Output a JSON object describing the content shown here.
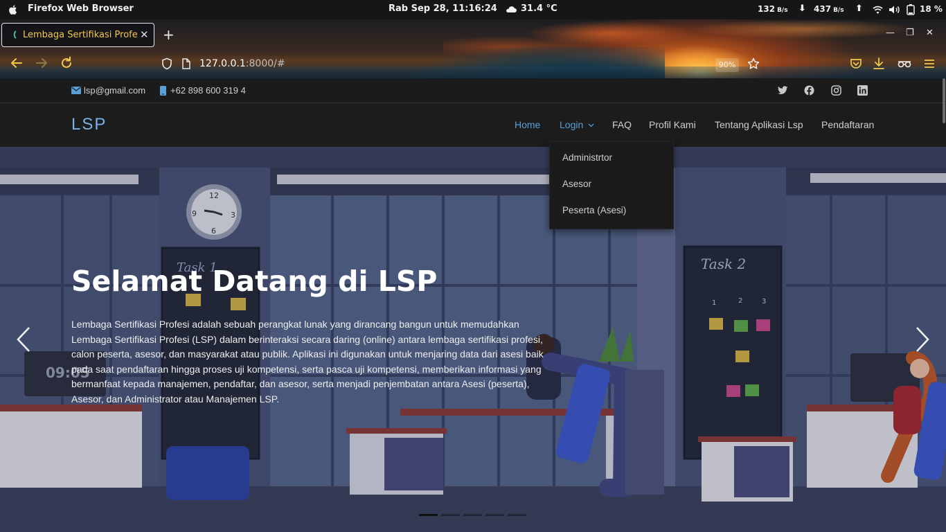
{
  "system_bar": {
    "app_name": "Firefox Web Browser",
    "datetime": "Rab Sep 28, 11:16:24",
    "temperature": "31.4 °C",
    "download_rate": "132",
    "download_unit": "B/s",
    "upload_rate": "437",
    "upload_unit": "B/s",
    "battery": "18 %"
  },
  "browser": {
    "tab_title": "Lembaga Sertifikasi Profesi",
    "new_tab": "+",
    "url_host": "127.0.0.1",
    "url_rest": ":8000/#",
    "zoom_level": "90%"
  },
  "topbar": {
    "email": "lsp@gmail.com",
    "phone": "+62 898 600 319 4"
  },
  "navbar": {
    "brand": "LSP",
    "links": [
      "Home",
      "Login",
      "FAQ",
      "Profil Kami",
      "Tentang Aplikasi Lsp",
      "Pendaftaran"
    ],
    "active": "Home"
  },
  "login_dropdown": {
    "items": [
      "Administrtor",
      "Asesor",
      "Peserta (Asesi)"
    ]
  },
  "hero": {
    "title": "Selamat Datang di LSP",
    "description": "Lembaga Sertifikasi Profesi adalah sebuah perangkat lunak yang dirancang bangun untuk memudahkan Lembaga Sertifikasi Profesi (LSP) dalam berinteraksi secara daring (online) antara lembaga sertifikasi profesi, calon peserta, asesor, dan masyarakat atau publik. Aplikasi ini digunakan untuk menjaring data dari asesi baik pada saat pendaftaran hingga proses uji kompetensi, serta pasca uji kompetensi, memberikan informasi yang bermanfaat kepada manajemen, pendaftar, dan asesor, serta menjadi penjembatan antara Asesi (peserta), Asesor, dan Administrator atau Manajemen LSP.",
    "clock_display": "09:05",
    "board_left_label": "Task 1",
    "board_right_label": "Task 2",
    "board_columns": [
      "1",
      "2",
      "3"
    ],
    "clock_numbers": [
      "12",
      "3",
      "6",
      "9"
    ],
    "carousel_slides": 5,
    "carousel_active_slide": 1
  },
  "colors": {
    "accent": "#5aa0d8",
    "tab_text": "#f2c94c",
    "nav_background": "#1c1c1c"
  },
  "icons": [
    "apple-icon",
    "weather-icon",
    "wifi-icon",
    "volume-icon",
    "battery-icon",
    "shield-icon",
    "page-icon",
    "star-icon",
    "pocket-icon",
    "download-icon",
    "mask-icon",
    "menu-icon",
    "envelope-icon",
    "phone-icon",
    "twitter-icon",
    "facebook-icon",
    "instagram-icon",
    "linkedin-icon",
    "chevron-left-icon",
    "chevron-right-icon"
  ]
}
